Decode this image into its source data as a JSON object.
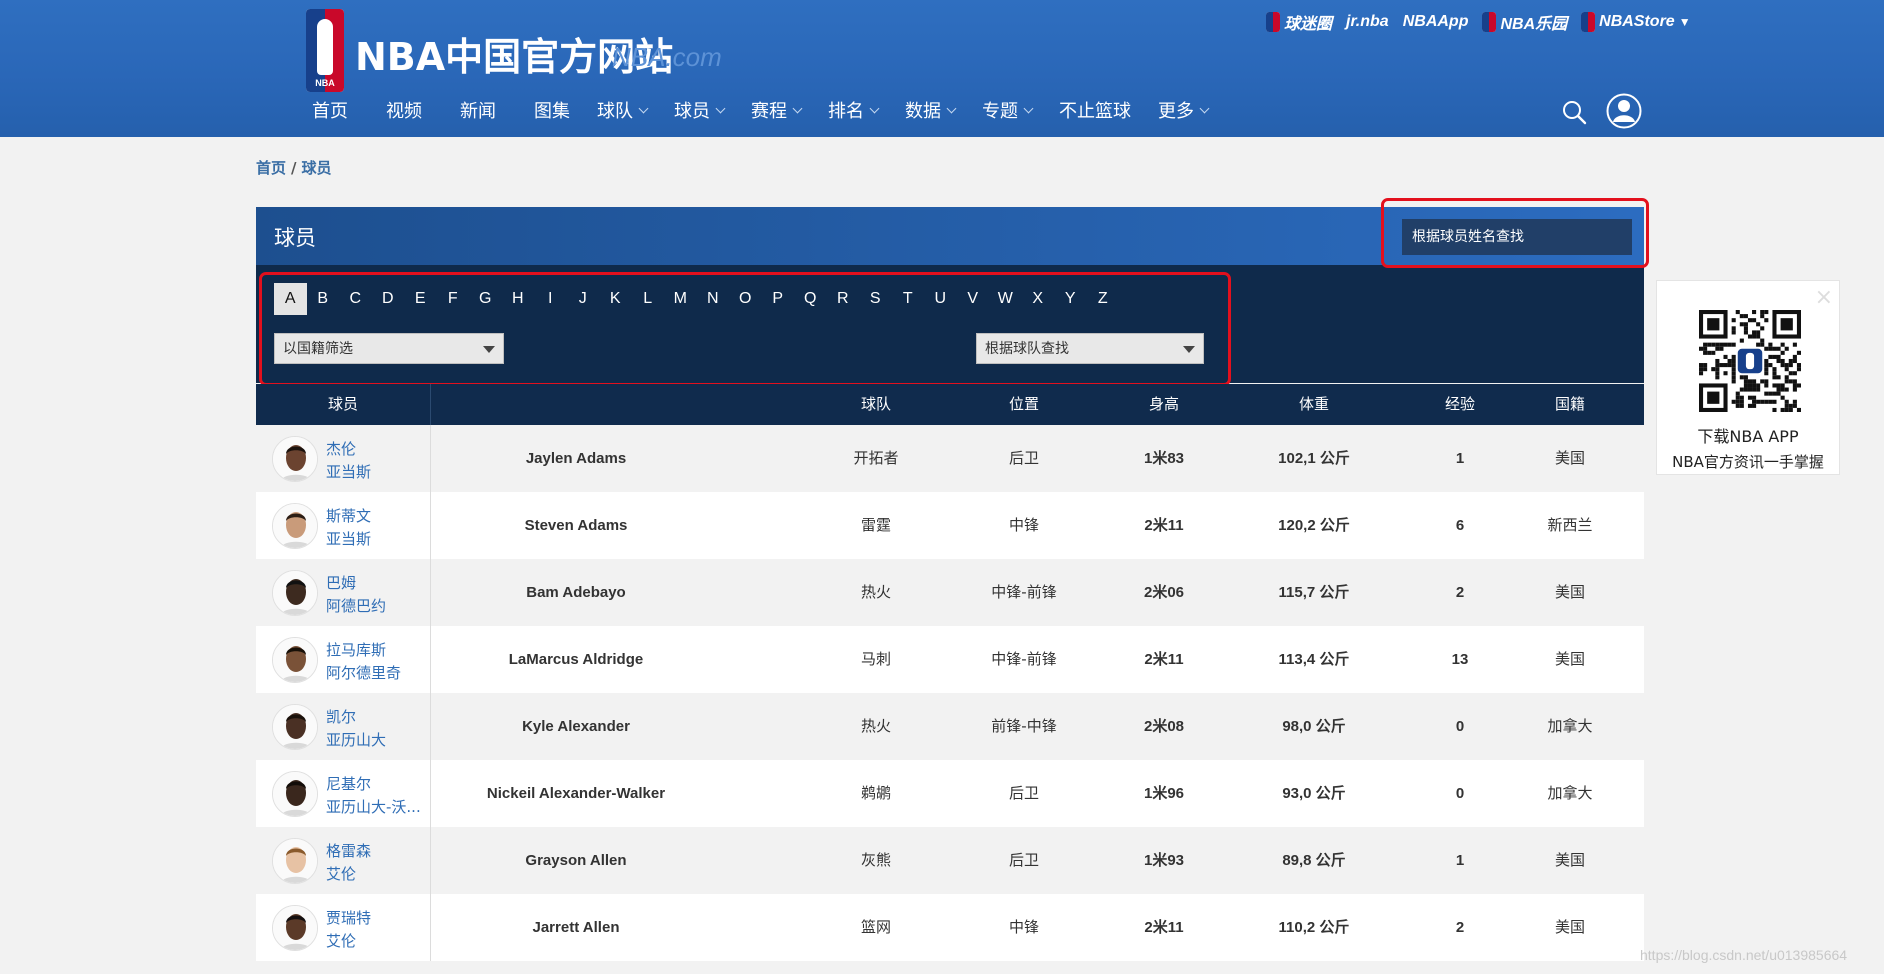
{
  "header": {
    "site_title": "NBA中国官方网站",
    "site_domain": "NBA.com",
    "logo_text": "NBA",
    "partners": [
      "球迷圈",
      "jr.nba",
      "NBAApp",
      "NBA乐园",
      "NBAStore"
    ],
    "nav": [
      {
        "label": "首页",
        "dropdown": false
      },
      {
        "label": "视频",
        "dropdown": false
      },
      {
        "label": "新闻",
        "dropdown": false
      },
      {
        "label": "图集",
        "dropdown": false
      },
      {
        "label": "球队",
        "dropdown": true
      },
      {
        "label": "球员",
        "dropdown": true
      },
      {
        "label": "赛程",
        "dropdown": true
      },
      {
        "label": "排名",
        "dropdown": true
      },
      {
        "label": "数据",
        "dropdown": true
      },
      {
        "label": "专题",
        "dropdown": true
      },
      {
        "label": "不止篮球",
        "dropdown": false
      },
      {
        "label": "更多",
        "dropdown": true
      }
    ]
  },
  "breadcrumb": {
    "home": "首页",
    "sep": "/",
    "current": "球员"
  },
  "panel": {
    "title": "球员",
    "search_placeholder": "根据球员姓名查找",
    "letters": [
      "A",
      "B",
      "C",
      "D",
      "E",
      "F",
      "G",
      "H",
      "I",
      "J",
      "K",
      "L",
      "M",
      "N",
      "O",
      "P",
      "Q",
      "R",
      "S",
      "T",
      "U",
      "V",
      "W",
      "X",
      "Y",
      "Z"
    ],
    "active_letter": "A",
    "nationality_filter": "以国籍筛选",
    "team_filter": "根据球队查找"
  },
  "table": {
    "headers": {
      "player": "球员",
      "team": "球队",
      "position": "位置",
      "height": "身高",
      "weight": "体重",
      "experience": "经验",
      "nationality": "国籍"
    },
    "rows": [
      {
        "first_cn": "杰伦",
        "last_cn": "亚当斯",
        "name_en": "Jaylen Adams",
        "team": "开拓者",
        "position": "后卫",
        "height": "1米83",
        "weight": "102,1 公斤",
        "experience": "1",
        "nationality": "美国"
      },
      {
        "first_cn": "斯蒂文",
        "last_cn": "亚当斯",
        "name_en": "Steven Adams",
        "team": "雷霆",
        "position": "中锋",
        "height": "2米11",
        "weight": "120,2 公斤",
        "experience": "6",
        "nationality": "新西兰"
      },
      {
        "first_cn": "巴姆",
        "last_cn": "阿德巴约",
        "name_en": "Bam Adebayo",
        "team": "热火",
        "position": "中锋-前锋",
        "height": "2米06",
        "weight": "115,7 公斤",
        "experience": "2",
        "nationality": "美国"
      },
      {
        "first_cn": "拉马库斯",
        "last_cn": "阿尔德里奇",
        "name_en": "LaMarcus Aldridge",
        "team": "马刺",
        "position": "中锋-前锋",
        "height": "2米11",
        "weight": "113,4 公斤",
        "experience": "13",
        "nationality": "美国"
      },
      {
        "first_cn": "凯尔",
        "last_cn": "亚历山大",
        "name_en": "Kyle Alexander",
        "team": "热火",
        "position": "前锋-中锋",
        "height": "2米08",
        "weight": "98,0 公斤",
        "experience": "0",
        "nationality": "加拿大"
      },
      {
        "first_cn": "尼基尔",
        "last_cn": "亚历山大-沃...",
        "name_en": "Nickeil Alexander-Walker",
        "team": "鹈鹕",
        "position": "后卫",
        "height": "1米96",
        "weight": "93,0 公斤",
        "experience": "0",
        "nationality": "加拿大"
      },
      {
        "first_cn": "格雷森",
        "last_cn": "艾伦",
        "name_en": "Grayson Allen",
        "team": "灰熊",
        "position": "后卫",
        "height": "1米93",
        "weight": "89,8 公斤",
        "experience": "1",
        "nationality": "美国"
      },
      {
        "first_cn": "贾瑞特",
        "last_cn": "艾伦",
        "name_en": "Jarrett Allen",
        "team": "篮网",
        "position": "中锋",
        "height": "2米11",
        "weight": "110,2 公斤",
        "experience": "2",
        "nationality": "美国"
      }
    ]
  },
  "qr": {
    "line1": "下载NBA APP",
    "line2": "NBA官方资讯一手掌握",
    "close": "×"
  },
  "watermark": "https://blog.csdn.net/u013985664",
  "colors": {
    "header_blue": "#2a67b8",
    "panel_navy": "#0f2a4b",
    "link_blue": "#2f6db5",
    "highlight_red": "#e3101d"
  }
}
